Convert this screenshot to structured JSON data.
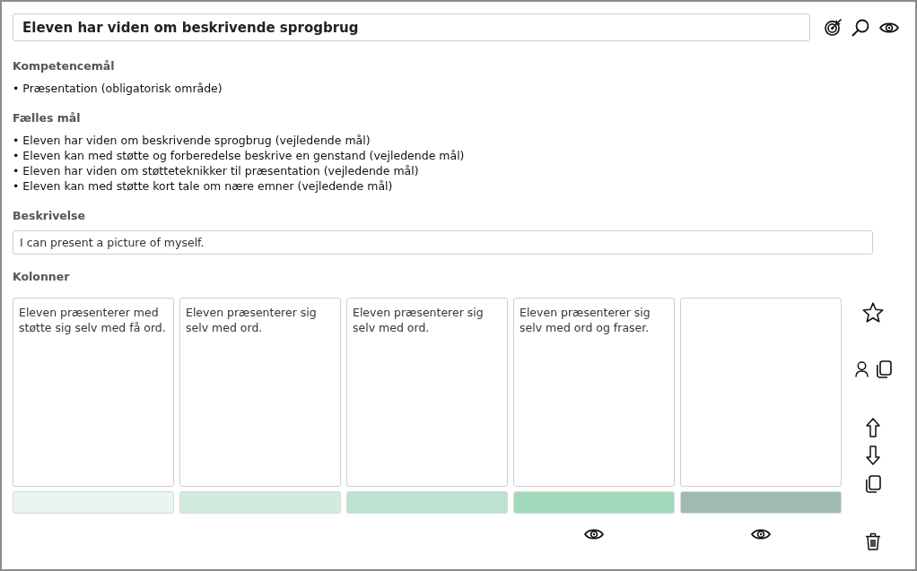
{
  "title": {
    "value": "Eleven har viden om beskrivende sprogbrug"
  },
  "kompetencemaal": {
    "heading": "Kompetencemål",
    "items": [
      "• Præsentation (obligatorisk område)"
    ]
  },
  "faelles_maal": {
    "heading": "Fælles mål",
    "items": [
      "• Eleven har viden om beskrivende sprogbrug (vejledende mål)",
      "• Eleven kan med støtte og forberedelse beskrive en genstand (vejledende mål)",
      "• Eleven har viden om støtteteknikker til præsentation (vejledende mål)",
      "• Eleven kan med støtte kort tale om nære emner (vejledende mål)"
    ]
  },
  "beskrivelse": {
    "heading": "Beskrivelse",
    "value": "I can present a picture of myself."
  },
  "kolonner": {
    "heading": "Kolonner",
    "columns": [
      {
        "text": "Eleven præsenterer med støtte sig selv med få ord.",
        "color": "#e8f4ee",
        "eye": false
      },
      {
        "text": "Eleven præsenterer sig selv med ord.",
        "color": "#d2ebdf",
        "eye": false
      },
      {
        "text": "Eleven præsenterer sig selv med ord.",
        "color": "#bce3cf",
        "eye": false
      },
      {
        "text": "Eleven præsenterer sig selv med ord og fraser.",
        "color": "#a3d9bb",
        "eye": true
      },
      {
        "color": "#9fbbb0",
        "eye": true
      }
    ]
  }
}
